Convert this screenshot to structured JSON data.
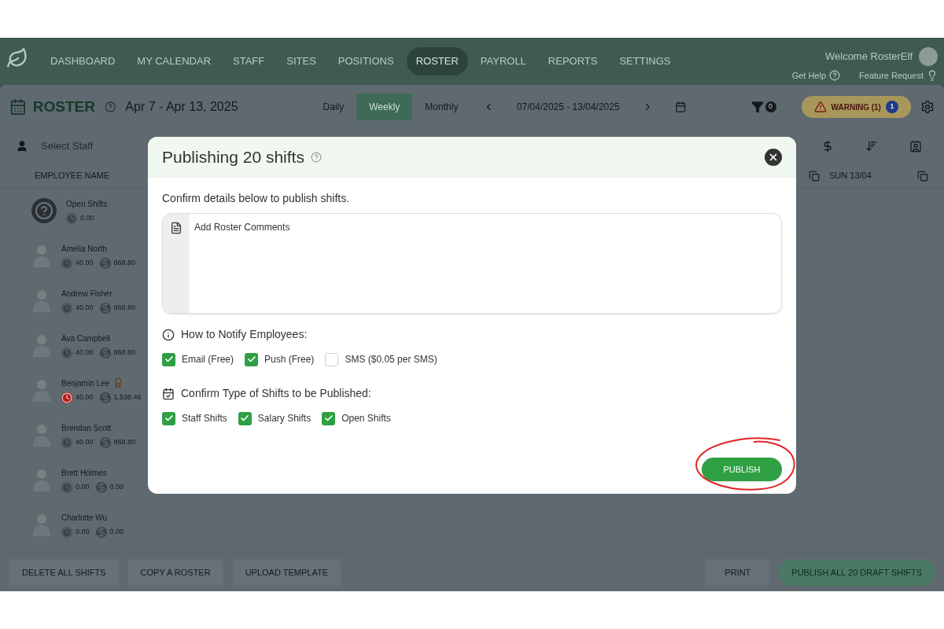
{
  "nav": {
    "items": [
      {
        "label": "DASHBOARD",
        "selected": false
      },
      {
        "label": "MY CALENDAR",
        "selected": false
      },
      {
        "label": "STAFF",
        "selected": false
      },
      {
        "label": "SITES",
        "selected": false
      },
      {
        "label": "POSITIONS",
        "selected": false
      },
      {
        "label": "ROSTER",
        "selected": true
      },
      {
        "label": "PAYROLL",
        "selected": false
      },
      {
        "label": "REPORTS",
        "selected": false
      },
      {
        "label": "SETTINGS",
        "selected": false
      }
    ],
    "welcome": "Welcome RosterElf",
    "get_help": "Get Help",
    "feature_request": "Feature Request"
  },
  "roster": {
    "title": "ROSTER",
    "range_title": "Apr 7 - Apr 13, 2025",
    "views": [
      {
        "label": "Daily",
        "selected": false
      },
      {
        "label": "Weekly",
        "selected": true
      },
      {
        "label": "Monthly",
        "selected": false
      }
    ],
    "date_range": "07/04/2025 - 13/04/2025",
    "filter_count": "0",
    "warning": "WARNING (1)",
    "warning_count": "1",
    "select_staff_placeholder": "Select Staff",
    "column_header": "EMPLOYEE NAME",
    "day_header": "SUN 13/04"
  },
  "employees": [
    {
      "kind": "open",
      "name": "Open Shifts",
      "hours": "0.00",
      "hours_alert": false,
      "flagged": false
    },
    {
      "kind": "staff",
      "name": "Amelia North",
      "hours": "40.00",
      "pay": "868.80",
      "hours_alert": false,
      "flagged": false
    },
    {
      "kind": "staff",
      "name": "Andrew Fisher",
      "hours": "40.00",
      "pay": "868.80",
      "hours_alert": false,
      "flagged": false
    },
    {
      "kind": "staff",
      "name": "Ava Campbell",
      "hours": "40.00",
      "pay": "868.80",
      "hours_alert": false,
      "flagged": false
    },
    {
      "kind": "staff",
      "name": "Benjamin Lee",
      "hours": "40.00",
      "pay": "1,538.46",
      "hours_alert": true,
      "flagged": true
    },
    {
      "kind": "staff",
      "name": "Brendan Scott",
      "hours": "40.00",
      "pay": "868.80",
      "hours_alert": false,
      "flagged": false
    },
    {
      "kind": "staff",
      "name": "Brett Holmes",
      "hours": "0.00",
      "pay": "0.00",
      "hours_alert": false,
      "flagged": false
    },
    {
      "kind": "staff",
      "name": "Charlotte Wu",
      "hours": "0.00",
      "pay": "0.00",
      "hours_alert": false,
      "flagged": false
    }
  ],
  "footer": {
    "left_buttons": [
      "DELETE ALL SHIFTS",
      "COPY A ROSTER",
      "UPLOAD TEMPLATE"
    ],
    "print": "PRINT",
    "publish_all": "PUBLISH ALL 20 DRAFT SHIFTS"
  },
  "dialog": {
    "title": "Publishing 20 shifts",
    "intro": "Confirm details below to publish shifts.",
    "comments_placeholder": "Add Roster Comments",
    "notify_heading": "How to Notify Employees:",
    "notify_options": [
      {
        "label": "Email (Free)",
        "checked": true
      },
      {
        "label": "Push (Free)",
        "checked": true
      },
      {
        "label": "SMS ($0.05 per SMS)",
        "checked": false
      }
    ],
    "types_heading": "Confirm Type of Shifts to be Published:",
    "type_options": [
      {
        "label": "Staff Shifts",
        "checked": true
      },
      {
        "label": "Salary Shifts",
        "checked": true
      },
      {
        "label": "Open Shifts",
        "checked": true
      }
    ],
    "publish": "PUBLISH"
  }
}
